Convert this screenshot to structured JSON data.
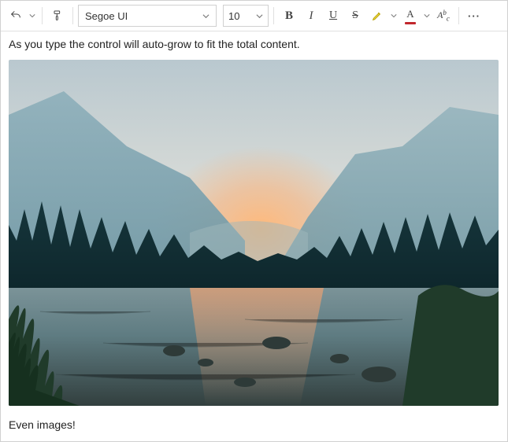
{
  "toolbar": {
    "undo_icon": "undo",
    "format_painter_icon": "format-painter",
    "font_family": "Segoe UI",
    "font_size": "10",
    "bold_glyph": "B",
    "italic_glyph": "I",
    "underline_glyph": "U",
    "strike_glyph": "S",
    "highlight_color": "#f0c400",
    "font_color": "#c1272d",
    "clear_format_glyph": "A",
    "more_glyph": "···"
  },
  "content": {
    "line1": "As you type the control will auto-grow to fit the total content.",
    "image_alt": "Yosemite Valley river at dusk with mountains, pine trees, and orange sky",
    "line2": "Even images!"
  }
}
